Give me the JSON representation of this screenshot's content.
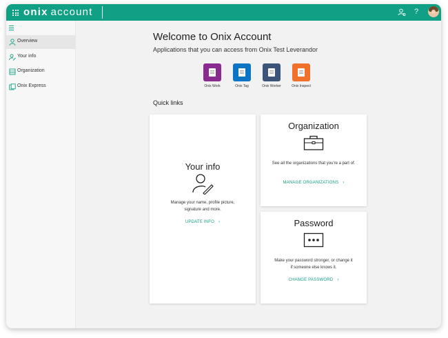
{
  "header": {
    "brand_bold": "onix",
    "brand_light": "account",
    "icons": [
      "waffle-icon",
      "org-switch-icon",
      "help-icon",
      "avatar"
    ],
    "help_label": "?",
    "accent": "#11a085"
  },
  "sidebar": {
    "items": [
      {
        "label": "Overview",
        "icon": "person-icon"
      },
      {
        "label": "Your info",
        "icon": "person-edit-icon"
      },
      {
        "label": "Organization",
        "icon": "building-icon"
      },
      {
        "label": "Onix Express",
        "icon": "app-icon"
      }
    ]
  },
  "main": {
    "title": "Welcome to Onix Account",
    "subtitle": "Applications that you can access from Onix Test Leverandor",
    "apps": [
      {
        "name": "Onix Work",
        "color": "#8a2b90"
      },
      {
        "name": "Onix Tag",
        "color": "#0c74c4"
      },
      {
        "name": "Onix Worker",
        "color": "#3c5478"
      },
      {
        "name": "Onix Inspect",
        "color": "#f0712b"
      }
    ],
    "quick_links_label": "Quick links",
    "cards": {
      "your_info": {
        "title": "Your info",
        "desc": "Manage your name, profile picture, signature and more.",
        "link": "UPDATE INFO"
      },
      "organization": {
        "title": "Organization",
        "desc": "See all the organizations that you're a part of.",
        "link": "MANAGE ORGANIZATIONS"
      },
      "password": {
        "title": "Password",
        "desc": "Make your password stronger, or change it if someone else knows it.",
        "link": "CHANGE PASSWORD"
      }
    }
  }
}
